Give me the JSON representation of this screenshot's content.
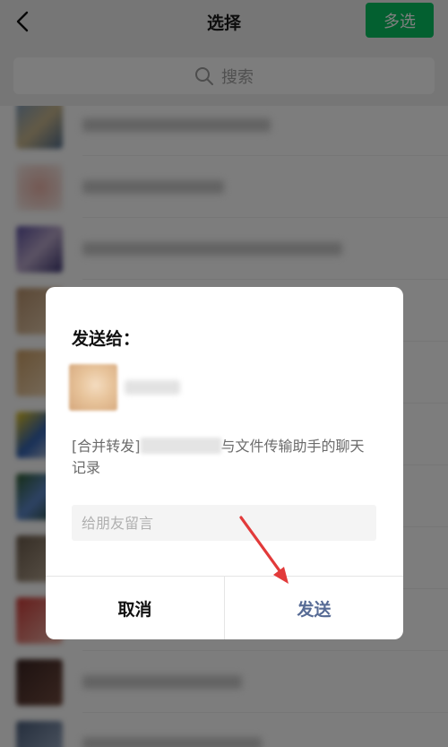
{
  "header": {
    "title": "选择",
    "multi_select_label": "多选",
    "back_icon": "chevron-left-icon"
  },
  "search": {
    "placeholder": "搜索",
    "icon": "search-icon"
  },
  "dialog": {
    "title": "发送给：",
    "recipient_name": "",
    "preview_prefix": "[合并转发]",
    "preview_suffix": "与文件传输助手的聊天记录",
    "message_placeholder": "给朋友留言",
    "cancel_label": "取消",
    "send_label": "发送"
  },
  "colors": {
    "accent_green": "#07c160",
    "link_blue": "#576b95",
    "annotation_red": "#e23a3a"
  }
}
